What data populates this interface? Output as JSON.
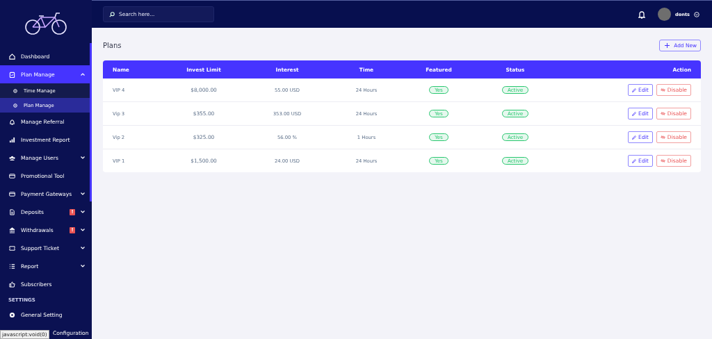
{
  "sidebar": {
    "items": [
      {
        "kind": "item",
        "label": "Dashboard",
        "selected": false
      },
      {
        "kind": "item",
        "label": "Plan Manage",
        "selected": true,
        "expanded": true,
        "children": [
          {
            "label": "Time Manage",
            "selected": false
          },
          {
            "label": "Plan Manage",
            "selected": true
          }
        ]
      },
      {
        "kind": "item",
        "label": "Manage Referral",
        "selected": false
      },
      {
        "kind": "item",
        "label": "Investment Report",
        "selected": false
      },
      {
        "kind": "item",
        "label": "Manage Users",
        "selected": false,
        "expanded": false
      },
      {
        "kind": "item",
        "label": "Promotional Tool",
        "selected": false
      },
      {
        "kind": "item",
        "label": "Payment Gateways",
        "selected": false,
        "expanded": false
      },
      {
        "kind": "item",
        "label": "Deposits",
        "selected": false,
        "expanded": false,
        "badge": "!"
      },
      {
        "kind": "item",
        "label": "Withdrawals",
        "selected": false,
        "expanded": false,
        "badge": "!"
      },
      {
        "kind": "item",
        "label": "Support Ticket",
        "selected": false,
        "expanded": false
      },
      {
        "kind": "item",
        "label": "Report",
        "selected": false,
        "expanded": false
      },
      {
        "kind": "item",
        "label": "Subscribers",
        "selected": false
      },
      {
        "kind": "section",
        "label": "SETTINGS"
      },
      {
        "kind": "item",
        "label": "General Setting",
        "selected": false
      },
      {
        "kind": "covered",
        "label": "Configuration",
        "selected": false
      }
    ]
  },
  "topbar": {
    "search": {
      "placeholder": "Search here..."
    },
    "user": {
      "name": "donts"
    }
  },
  "page": {
    "title": "Plans",
    "add_button": "Add New"
  },
  "table": {
    "columns": [
      "Name",
      "Invest Limit",
      "Interest",
      "Time",
      "Featured",
      "Status",
      "Action"
    ],
    "rows": [
      {
        "name": "VIP 4",
        "invest_limit": "$8,000.00",
        "interest": "55.00 USD",
        "time": "24 Hours",
        "featured": "Yes",
        "status": "Active",
        "edit": "Edit",
        "disable": "Disable"
      },
      {
        "name": "Vip 3",
        "invest_limit": "$355.00",
        "interest": "353.00 USD",
        "time": "24 Hours",
        "featured": "Yes",
        "status": "Active",
        "edit": "Edit",
        "disable": "Disable"
      },
      {
        "name": "Vip 2",
        "invest_limit": "$325.00",
        "interest": "56.00 %",
        "time": "1 Hours",
        "featured": "Yes",
        "status": "Active",
        "edit": "Edit",
        "disable": "Disable"
      },
      {
        "name": "VIP 1",
        "invest_limit": "$1,500.00",
        "interest": "24.00 USD",
        "time": "24 Hours",
        "featured": "Yes",
        "status": "Active",
        "edit": "Edit",
        "disable": "Disable"
      }
    ]
  },
  "status_tooltip": "javascript:void(0)"
}
